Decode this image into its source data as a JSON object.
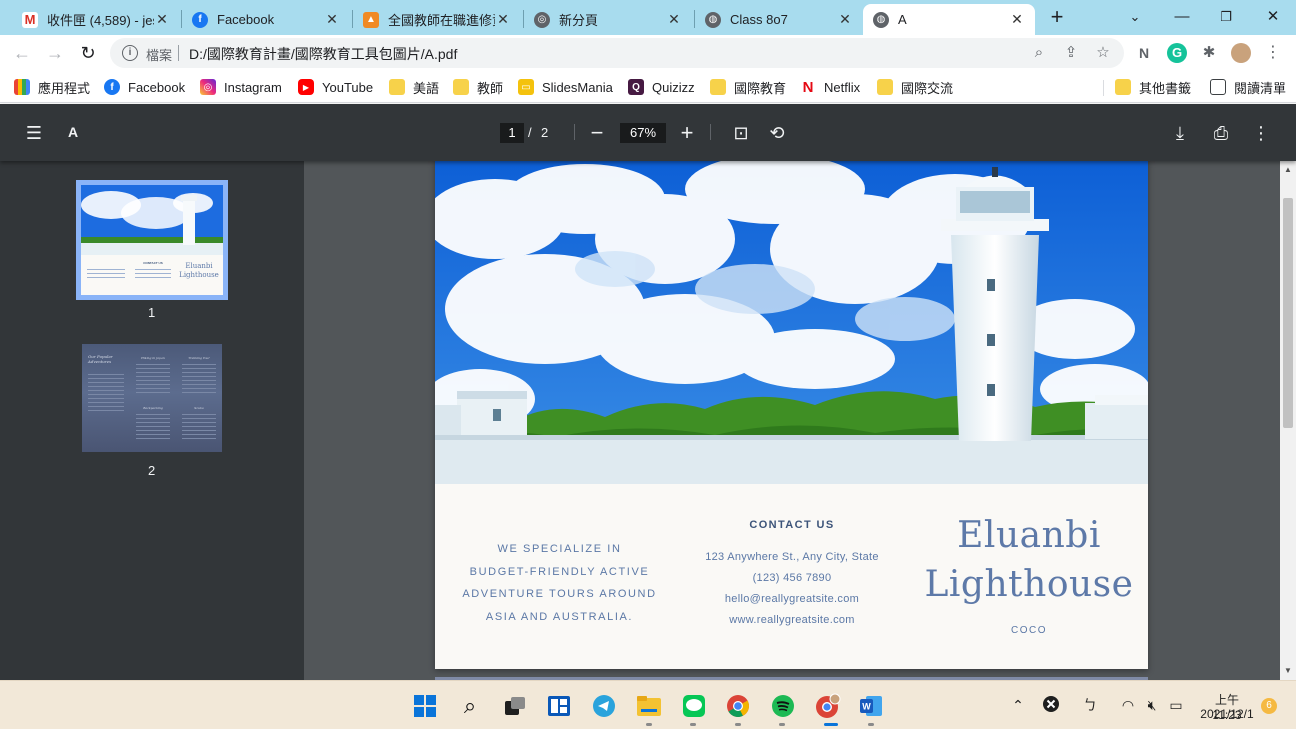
{
  "tabs": [
    {
      "title": "收件匣 (4,589) - jes",
      "icon": "gmail-icon",
      "active": false
    },
    {
      "title": "Facebook",
      "icon": "facebook-icon",
      "active": false
    },
    {
      "title": "全國教師在職進修資",
      "icon": "shield-icon",
      "active": false
    },
    {
      "title": "新分頁",
      "icon": "chrome-icon",
      "active": false
    },
    {
      "title": "Class 8o7",
      "icon": "globe-icon",
      "active": false
    },
    {
      "title": "A",
      "icon": "globe-icon",
      "active": true
    }
  ],
  "omnibox": {
    "scheme_label": "檔案",
    "url": "D:/國際教育計畫/國際教育工具包圖片/A.pdf"
  },
  "bookmarks": [
    {
      "label": "應用程式",
      "icon": "apps-grid-icon"
    },
    {
      "label": "Facebook",
      "icon": "facebook-icon"
    },
    {
      "label": "Instagram",
      "icon": "instagram-icon"
    },
    {
      "label": "YouTube",
      "icon": "youtube-icon"
    },
    {
      "label": "美語",
      "icon": "folder-icon"
    },
    {
      "label": "教師",
      "icon": "folder-icon"
    },
    {
      "label": "SlidesMania",
      "icon": "slides-icon"
    },
    {
      "label": "Quizizz",
      "icon": "quizizz-icon"
    },
    {
      "label": "國際教育",
      "icon": "folder-icon"
    },
    {
      "label": "Netflix",
      "icon": "netflix-icon"
    },
    {
      "label": "國際交流",
      "icon": "folder-icon"
    },
    {
      "label": "其他書籤",
      "icon": "folder-icon"
    },
    {
      "label": "閱讀清單",
      "icon": "reading-list-icon"
    }
  ],
  "pdf_toolbar": {
    "title": "A",
    "current_page": "1",
    "separator": "/",
    "total_pages": "2",
    "zoom": "67%"
  },
  "thumbnails": [
    {
      "label": "1",
      "selected": true
    },
    {
      "label": "2",
      "selected": false
    }
  ],
  "thumb1_text": {
    "brand_line1": "Eluanbi",
    "brand_line2": "Lighthouse",
    "contact": "CONTACT US"
  },
  "thumb2_text": {
    "heading1": "Our Popular Adventures",
    "heading2": "Hiking in Japan",
    "heading3": "Trekking Tour",
    "heading4": "Backpacking",
    "heading5": "Scuba"
  },
  "brochure": {
    "tagline": [
      "WE SPECIALIZE IN",
      "BUDGET-FRIENDLY ACTIVE",
      "ADVENTURE TOURS AROUND",
      "ASIA AND AUSTRALIA."
    ],
    "contact_heading": "CONTACT US",
    "address": "123 Anywhere St., Any City, State",
    "phone": "(123) 456 7890",
    "email": "hello@reallygreatsite.com",
    "website": "www.reallygreatsite.com",
    "brand_line1": "Eluanbi",
    "brand_line2": "Lighthouse",
    "brand_sub": "COCO"
  },
  "taskbar": {
    "apps": [
      "windows-start-icon",
      "search-icon",
      "task-view-icon",
      "widgets-icon",
      "telegram-icon",
      "file-explorer-icon",
      "line-icon",
      "chrome-icon",
      "spotify-icon",
      "chrome-profile-icon",
      "word-icon"
    ],
    "clock_time": "上午 11:23",
    "clock_date": "2021/12/1",
    "notification_count": "6"
  },
  "colors": {
    "tabstrip": "#a8dcee",
    "pdf_toolbar": "#323639",
    "viewer_bg": "#525659",
    "brochure_text": "#5b78a6",
    "taskbar": "#f2e8d8"
  }
}
